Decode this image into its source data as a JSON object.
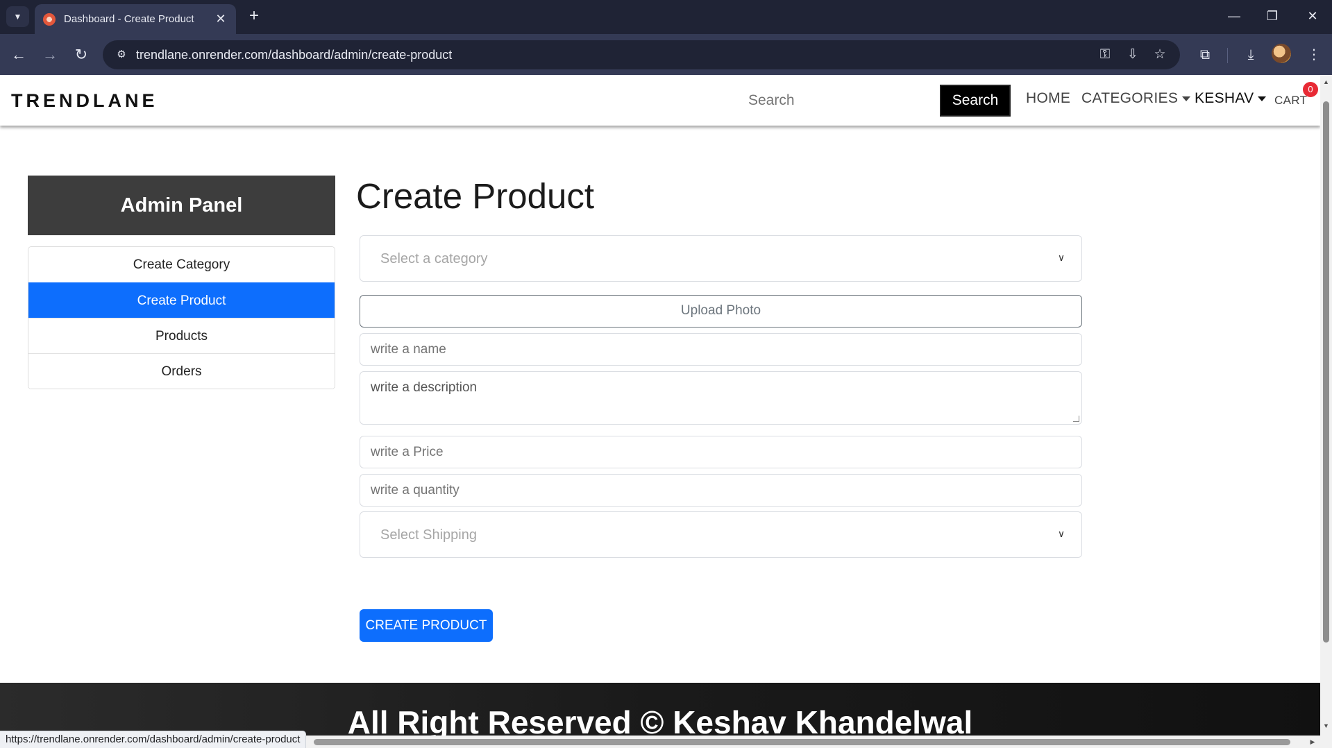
{
  "browser": {
    "tab_title": "Dashboard - Create Product",
    "tab_close": "✕",
    "new_tab": "+",
    "url": "trendlane.onrender.com/dashboard/admin/create-product",
    "window_controls": {
      "minimize": "—",
      "restore": "❐",
      "close": "✕"
    },
    "icons": [
      "back-icon",
      "forward-icon",
      "reload-icon",
      "site-info-icon",
      "password-key-icon",
      "install-app-icon",
      "bookmark-star-icon",
      "extensions-icon",
      "download-icon",
      "profile-avatar",
      "more-menu-icon"
    ],
    "status_url": "https://trendlane.onrender.com/dashboard/admin/create-product"
  },
  "navbar": {
    "brand": "TRENDLANE",
    "search_placeholder": "Search",
    "search_button": "Search",
    "home": "HOME",
    "categories": "CATEGORIES",
    "user": "KESHAV",
    "cart": "CART",
    "cart_count": "0"
  },
  "sidebar": {
    "title": "Admin Panel",
    "items": [
      {
        "label": "Create Category",
        "active": false
      },
      {
        "label": "Create Product",
        "active": true
      },
      {
        "label": "Products",
        "active": false
      },
      {
        "label": "Orders",
        "active": false
      }
    ]
  },
  "form": {
    "title": "Create Product",
    "category_placeholder": "Select a category",
    "upload_label": "Upload Photo",
    "name_placeholder": "write a name",
    "description_placeholder": "write a description",
    "price_placeholder": "write a Price",
    "quantity_placeholder": "write a quantity",
    "shipping_placeholder": "Select Shipping",
    "submit_label": "CREATE PRODUCT"
  },
  "footer": {
    "text": "All Right Reserved © Keshav Khandelwal"
  },
  "colors": {
    "primary": "#0d6efd",
    "sidebar_header": "#3d3d3d",
    "cart_badge": "#e82a35",
    "browser_frame": "#1f2335",
    "browser_toolbar": "#343a55"
  }
}
